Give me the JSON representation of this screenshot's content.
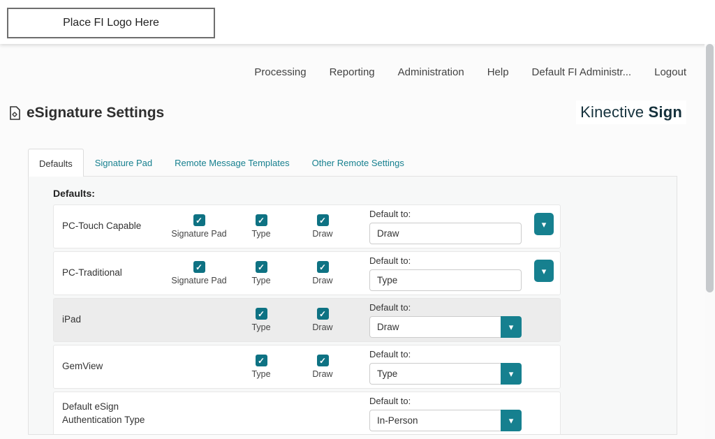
{
  "header": {
    "logo_placeholder": "Place FI Logo Here"
  },
  "nav": {
    "items": [
      {
        "label": "Processing"
      },
      {
        "label": "Reporting"
      },
      {
        "label": "Administration"
      },
      {
        "label": "Help"
      },
      {
        "label": "Default FI Administr..."
      },
      {
        "label": "Logout"
      }
    ]
  },
  "page": {
    "title": "eSignature Settings",
    "brand": {
      "name": "Kinective",
      "product": "Sign"
    }
  },
  "tabs": [
    {
      "label": "Defaults",
      "active": true
    },
    {
      "label": "Signature Pad",
      "active": false
    },
    {
      "label": "Remote Message Templates",
      "active": false
    },
    {
      "label": "Other Remote Settings",
      "active": false
    }
  ],
  "panel": {
    "heading": "Defaults:",
    "default_to_label": "Default to:",
    "rows": [
      {
        "label": "PC-Touch Capable",
        "checkboxes": [
          {
            "label": "Signature Pad",
            "checked": true
          },
          {
            "label": "Type",
            "checked": true
          },
          {
            "label": "Draw",
            "checked": true
          }
        ],
        "default_value": "Draw",
        "dropdown": "detached"
      },
      {
        "label": "PC-Traditional",
        "checkboxes": [
          {
            "label": "Signature Pad",
            "checked": true
          },
          {
            "label": "Type",
            "checked": true
          },
          {
            "label": "Draw",
            "checked": true
          }
        ],
        "default_value": "Type",
        "dropdown": "detached"
      },
      {
        "label": "iPad",
        "checkboxes": [
          {
            "label": "Type",
            "checked": true
          },
          {
            "label": "Draw",
            "checked": true
          }
        ],
        "default_value": "Draw",
        "dropdown": "attached",
        "shaded": true
      },
      {
        "label": "GemView",
        "checkboxes": [
          {
            "label": "Type",
            "checked": true
          },
          {
            "label": "Draw",
            "checked": true
          }
        ],
        "default_value": "Type",
        "dropdown": "attached"
      },
      {
        "label": "Default eSign Authentication Type",
        "checkboxes": [],
        "default_value": "In-Person",
        "dropdown": "attached"
      }
    ]
  },
  "icons": {
    "check": "✓",
    "chevron_down": "▾"
  },
  "colors": {
    "accent_teal": "#0e7283",
    "button_teal": "#16808f",
    "tab_link": "#17808f",
    "brand_dark": "#15313c",
    "panel_bg": "#f7f8f8",
    "shaded_row_bg": "#ececec"
  }
}
